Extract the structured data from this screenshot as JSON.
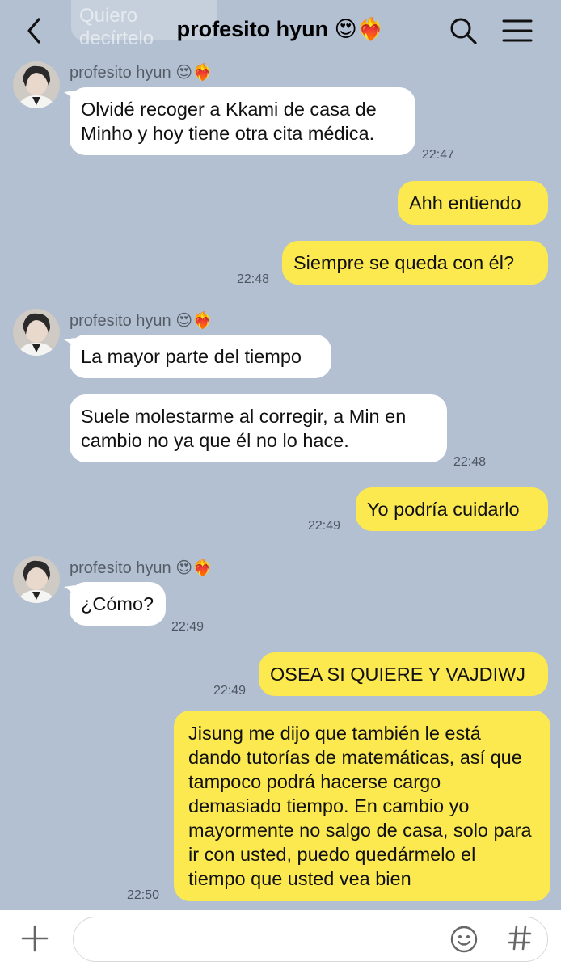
{
  "header": {
    "title": "profesito hyun",
    "title_emoji": "😍❤️‍🔥",
    "ghost_text": "Quiero decírtelo"
  },
  "messages": [
    {
      "side": "in",
      "sender": "profesito hyun 😍❤️‍🔥",
      "text": "Olvidé recoger a Kkami de casa de Minho y hoy tiene otra cita médica.",
      "time": "22:47"
    },
    {
      "side": "out",
      "text": "Ahh entiendo",
      "time": ""
    },
    {
      "side": "out",
      "text": "Siempre se queda con él?",
      "time": "22:48"
    },
    {
      "side": "in",
      "sender": "profesito hyun 😍❤️‍🔥",
      "text": "La mayor parte del tiempo",
      "time": ""
    },
    {
      "side": "in",
      "text": "Suele molestarme al corregir, a Min en cambio no ya que él no lo hace.",
      "time": "22:48"
    },
    {
      "side": "out",
      "text": "Yo podría cuidarlo",
      "time": "22:49"
    },
    {
      "side": "in",
      "sender": "profesito hyun 😍❤️‍🔥",
      "text": "¿Cómo?",
      "time": "22:49"
    },
    {
      "side": "out",
      "text": "OSEA SI QUIERE Y VAJDIWJ",
      "time": "22:49"
    },
    {
      "side": "out",
      "text": "Jisung me dijo que también le está dando tutorías de matemáticas, así que tampoco podrá hacerse cargo demasiado tiempo. En cambio yo mayormente no salgo de casa, solo para ir con usted, puedo quedármelo el tiempo que usted vea bien",
      "time": "22:50"
    }
  ],
  "colors": {
    "background": "#b2c0d1",
    "incoming": "#ffffff",
    "outgoing": "#fbe94f"
  },
  "icons": [
    "back-icon",
    "search-icon",
    "menu-icon",
    "plus-icon",
    "emoji-icon",
    "hash-icon"
  ]
}
